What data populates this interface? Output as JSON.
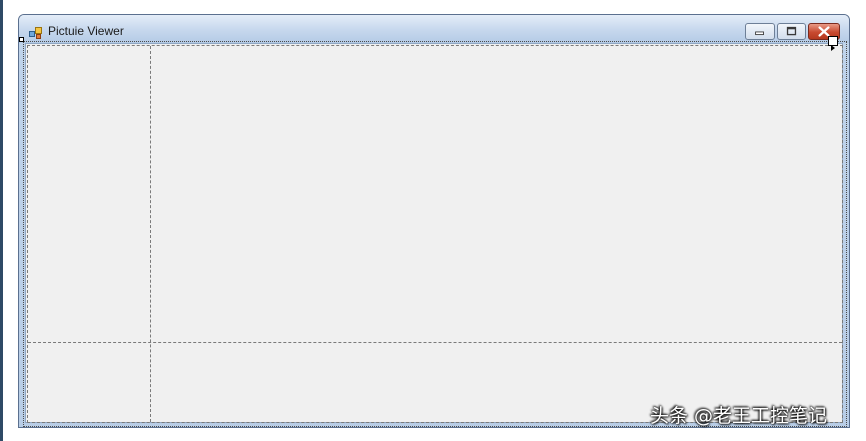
{
  "window": {
    "title": "Pictuie Viewer",
    "icon": "form-icon"
  },
  "caption_buttons": {
    "minimize": "minimize-icon",
    "maximize": "maximize-icon",
    "close": "close-icon"
  },
  "layout": {
    "type": "table-layout-panel",
    "columns": 2,
    "rows": 2
  },
  "watermark": {
    "text": "头条 @老王工控笔记"
  },
  "colors": {
    "client_background": "#f0f0f0",
    "titlebar": "#c8d9ee",
    "close_button": "#c84a30"
  }
}
